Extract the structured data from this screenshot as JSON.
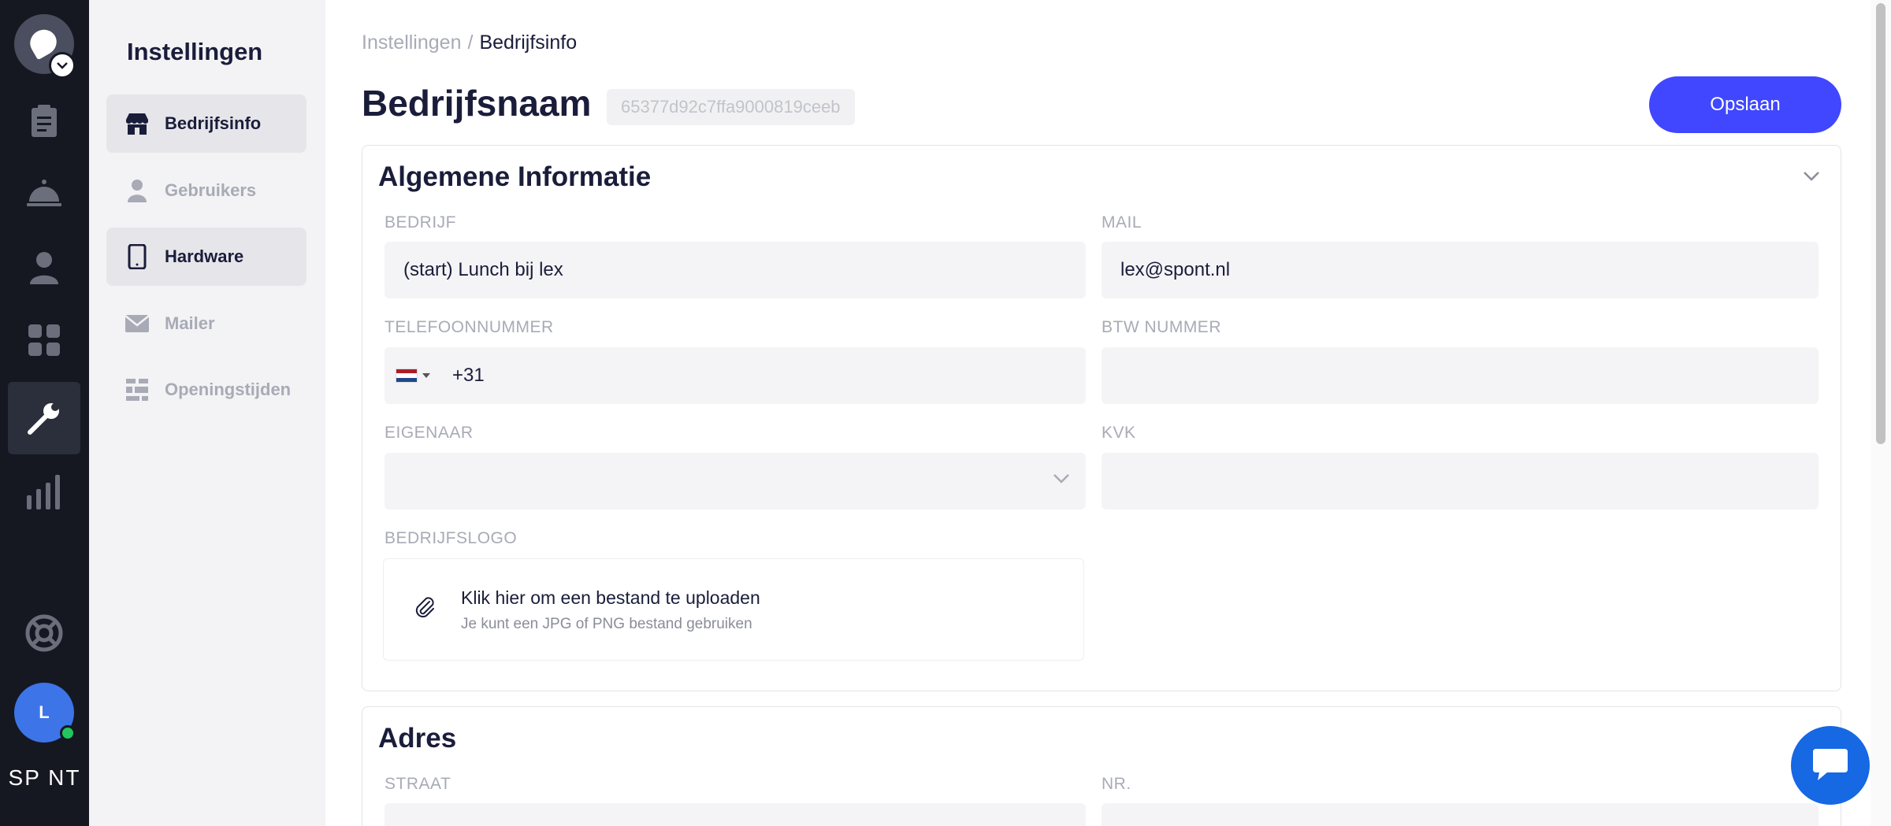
{
  "rail": {
    "brand": "SP NT",
    "avatar_initial": "L",
    "items": [
      "orders-icon",
      "service-bell-icon",
      "user-icon",
      "grid-icon",
      "wrench-icon",
      "bar-chart-icon",
      "lifebuoy-icon"
    ]
  },
  "subnav": {
    "title": "Instellingen",
    "items": [
      {
        "label": "Bedrijfsinfo",
        "icon": "store-icon"
      },
      {
        "label": "Gebruikers",
        "icon": "user-icon"
      },
      {
        "label": "Hardware",
        "icon": "tablet-icon"
      },
      {
        "label": "Mailer",
        "icon": "mail-icon"
      },
      {
        "label": "Openingstijden",
        "icon": "calendar-grid-icon"
      }
    ]
  },
  "breadcrumb": {
    "parent": "Instellingen",
    "separator": "/",
    "current": "Bedrijfsinfo"
  },
  "header": {
    "title": "Bedrijfsnaam",
    "id": "65377d92c7ffa9000819ceeb",
    "save_label": "Opslaan"
  },
  "general": {
    "title": "Algemene Informatie",
    "company_label": "BEDRIJF",
    "company_value": "(start) Lunch bij lex",
    "mail_label": "MAIL",
    "mail_value": "lex@spont.nl",
    "phone_label": "TELEFOONNUMMER",
    "phone_dial": "+31",
    "vat_label": "BTW NUMMER",
    "vat_value": "",
    "owner_label": "EIGENAAR",
    "owner_value": "",
    "kvk_label": "KVK",
    "kvk_value": "",
    "logo_label": "BEDRIJFSLOGO",
    "upload_title": "Klik hier om een bestand te uploaden",
    "upload_hint": "Je kunt een JPG of PNG bestand gebruiken"
  },
  "address": {
    "title": "Adres",
    "street_label": "STRAAT",
    "number_label": "NR."
  },
  "colors": {
    "accent": "#4047ff",
    "rail": "#151821",
    "chat": "#1668e3"
  }
}
